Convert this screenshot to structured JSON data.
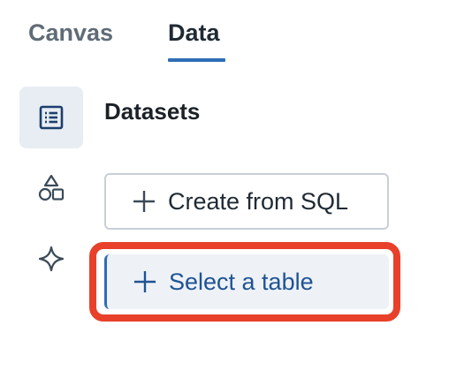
{
  "tabs": [
    {
      "label": "Canvas",
      "active": false
    },
    {
      "label": "Data",
      "active": true
    }
  ],
  "rail": {
    "items": [
      {
        "icon": "list-icon",
        "active": true
      },
      {
        "icon": "shapes-icon",
        "active": false
      },
      {
        "icon": "sparkle-icon",
        "active": false
      }
    ]
  },
  "section": {
    "title": "Datasets"
  },
  "actions": {
    "create_sql_label": "Create from SQL",
    "select_table_label": "Select a table"
  },
  "colors": {
    "accent": "#2f6db5",
    "highlight": "#e8402a",
    "active_bg": "#e8edf3"
  }
}
